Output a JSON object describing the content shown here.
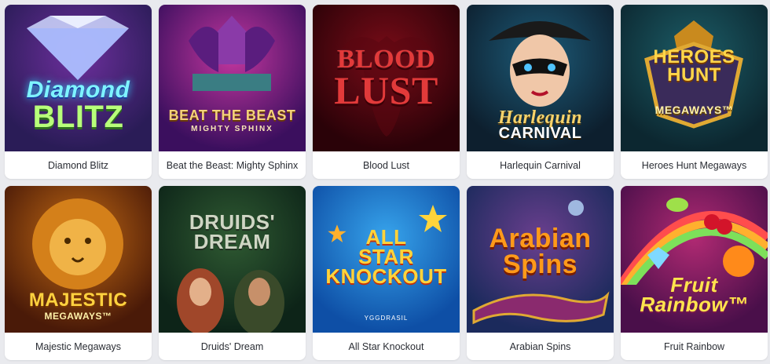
{
  "games": [
    {
      "title": "Diamond Blitz",
      "logo_lines": [
        "Diamond",
        "BLITZ"
      ],
      "bg": [
        "#2a1c57",
        "#6c2f9c"
      ],
      "logo_color": "#7ef3ff",
      "icon": "diamond-icon"
    },
    {
      "title": "Beat the Beast: Mighty Sphinx",
      "logo_lines": [
        "BEAT THE BEAST",
        "MIGHTY SPHINX"
      ],
      "bg": [
        "#3b0f5e",
        "#c2369e"
      ],
      "logo_color": "#f4d27a",
      "icon": "sphinx-icon"
    },
    {
      "title": "Blood Lust",
      "logo_lines": [
        "BLOOD",
        "LUST"
      ],
      "bg": [
        "#2a0208",
        "#7a0c18"
      ],
      "logo_color": "#e23a3a",
      "icon": "bat-icon"
    },
    {
      "title": "Harlequin Carnival",
      "logo_lines": [
        "Harlequin",
        "CARNIVAL"
      ],
      "bg": [
        "#0d1f2e",
        "#1d5b78"
      ],
      "logo_color": "#f6d36b",
      "icon": "mask-icon"
    },
    {
      "title": "Heroes Hunt Megaways",
      "logo_lines": [
        "HEROES",
        "HUNT",
        "MEGAWAYS™"
      ],
      "bg": [
        "#0c2730",
        "#1c5d67"
      ],
      "logo_color": "#ffd64a",
      "icon": "dragon-icon"
    },
    {
      "title": "Majestic Megaways",
      "logo_lines": [
        "MAJESTIC",
        "MEGAWAYS™"
      ],
      "bg": [
        "#4a1a08",
        "#c26a14"
      ],
      "logo_color": "#ffd23f",
      "icon": "lion-icon"
    },
    {
      "title": "Druids' Dream",
      "logo_lines": [
        "DRUIDS'",
        "DREAM"
      ],
      "bg": [
        "#0d2418",
        "#2f5a32"
      ],
      "logo_color": "#cfd6c4",
      "icon": "druid-icon"
    },
    {
      "title": "All Star Knockout",
      "logo_lines": [
        "ALL",
        "STAR",
        "KNOCKOUT"
      ],
      "bg": [
        "#0e4fa6",
        "#37a4ec"
      ],
      "logo_color": "#ffd43b",
      "icon": "star-icon",
      "badge": "YGGDRASIL"
    },
    {
      "title": "Arabian Spins",
      "logo_lines": [
        "Arabian",
        "Spins"
      ],
      "bg": [
        "#1b2a5c",
        "#6a3f8e"
      ],
      "logo_color": "#ff9a1a",
      "icon": "carpet-icon"
    },
    {
      "title": "Fruit Rainbow",
      "logo_lines": [
        "Fruit",
        "Rainbow™"
      ],
      "bg": [
        "#4a0f4a",
        "#b12a73"
      ],
      "logo_color": "#ffe44d",
      "icon": "fruit-icon"
    }
  ]
}
